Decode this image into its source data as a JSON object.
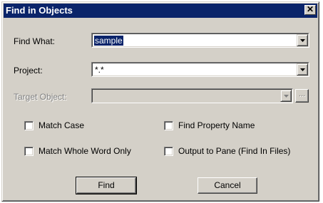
{
  "window": {
    "title": "Find in Objects",
    "close_glyph": "✕"
  },
  "fields": {
    "find_what": {
      "label": "Find What:",
      "value": "sample"
    },
    "project": {
      "label": "Project:",
      "value": "*.*"
    },
    "target_object": {
      "label": "Target Object:",
      "value": "",
      "browse_label": "..."
    }
  },
  "options": [
    {
      "label": "Match Case",
      "checked": false
    },
    {
      "label": "Find Property Name",
      "checked": false
    },
    {
      "label": "Match Whole Word Only",
      "checked": false
    },
    {
      "label": "Output to Pane (Find In Files)",
      "checked": false
    }
  ],
  "buttons": {
    "find": "Find",
    "cancel": "Cancel"
  },
  "colors": {
    "face": "#d4d0c8",
    "titlebar": "#0a246a",
    "selection": "#0a246a"
  },
  "icons": {
    "dropdown": "chevron-down-icon",
    "close": "close-icon"
  }
}
